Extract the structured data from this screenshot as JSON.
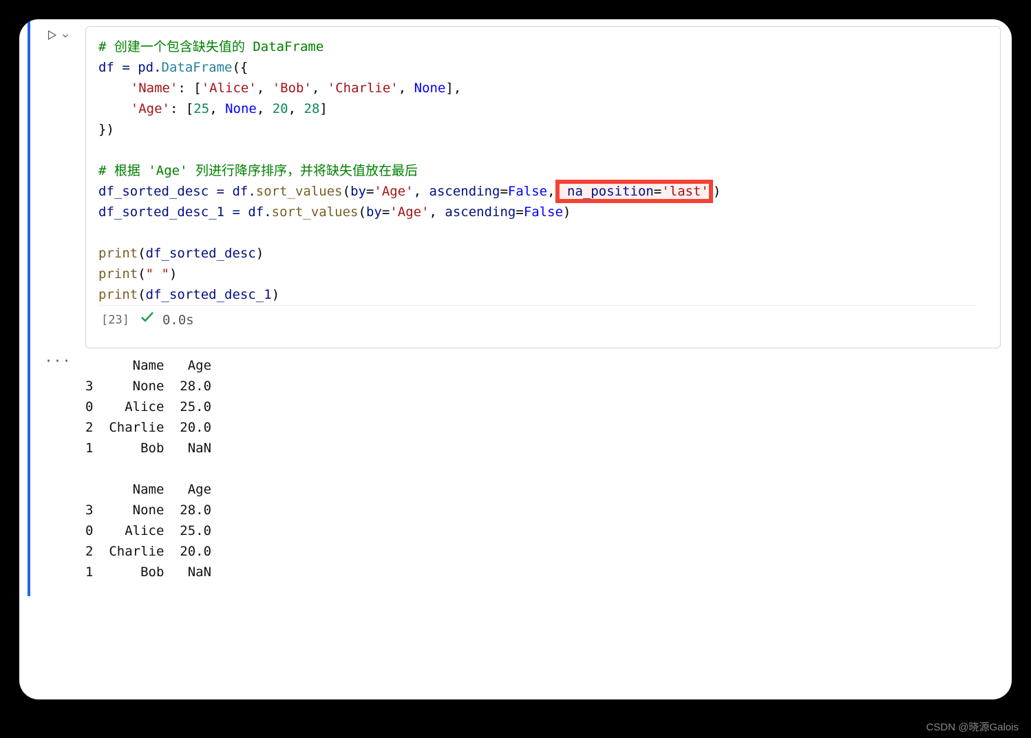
{
  "cell": {
    "execution_count": "[23]",
    "execution_time": "0.0s",
    "code": {
      "l1_comment": "# 创建一个包含缺失值的 DataFrame",
      "l2_a": "df = pd.",
      "l2_b": "DataFrame",
      "l2_c": "({",
      "l3_key": "'Name'",
      "l3_v1": "'Alice'",
      "l3_v2": "'Bob'",
      "l3_v3": "'Charlie'",
      "l3_none": "None",
      "l4_key": "'Age'",
      "l4_v1": "25",
      "l4_none": "None",
      "l4_v2": "20",
      "l4_v3": "28",
      "l5": "})",
      "l6_comment": "# 根据 'Age' 列进行降序排序，并将缺失值放在最后",
      "l7_a": "df_sorted_desc = df.",
      "l7_fn": "sort_values",
      "l7_by": "by",
      "l7_age": "'Age'",
      "l7_asc": "ascending",
      "l7_false": "False",
      "l7_hi_key": " na_position",
      "l7_hi_val": "'last'",
      "l8_a": "df_sorted_desc_1 = df.",
      "l8_fn": "sort_values",
      "l9_fn": "print",
      "l9_arg": "df_sorted_desc",
      "l10_arg": "\" \"",
      "l11_arg": "df_sorted_desc_1"
    }
  },
  "output": "      Name   Age\n3     None  28.0\n0    Alice  25.0\n2  Charlie  20.0\n1      Bob   NaN\n \n      Name   Age\n3     None  28.0\n0    Alice  25.0\n2  Charlie  20.0\n1      Bob   NaN",
  "watermark": "CSDN @晓源Galois"
}
